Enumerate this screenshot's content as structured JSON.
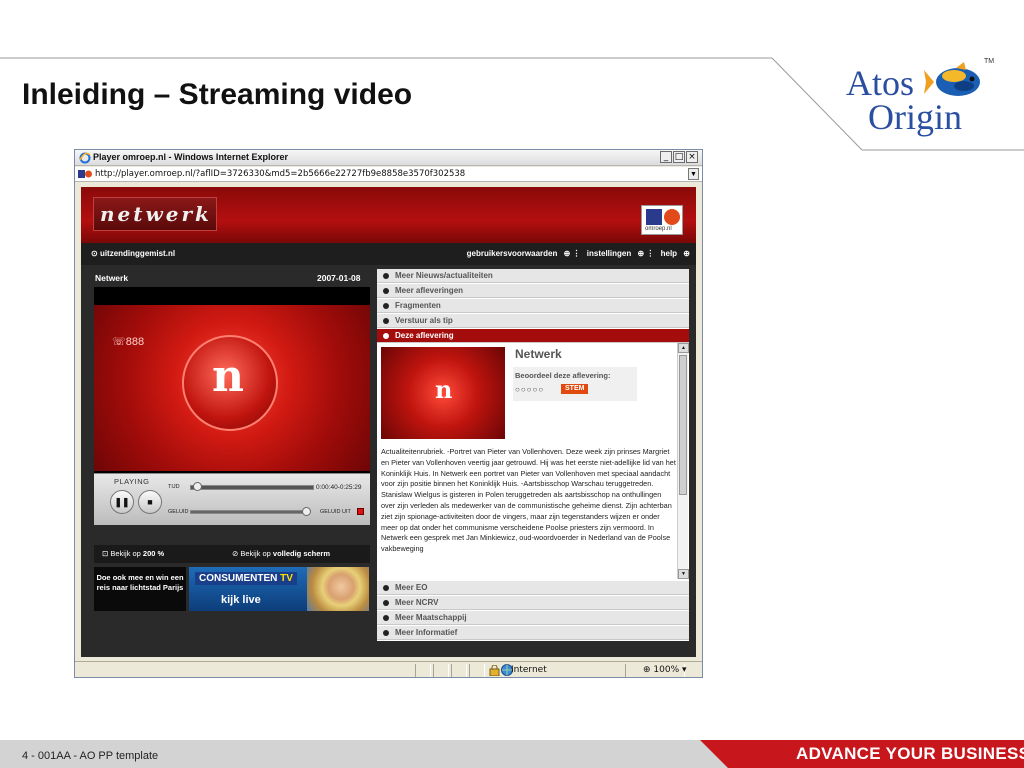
{
  "slide": {
    "title": "Inleiding – Streaming video",
    "footer_text": "4 - 001AA - AO PP template",
    "footer_slogan": "ADVANCE YOUR BUSINESS",
    "footer_arrows": "»",
    "logo_line1": "Atos",
    "logo_line2": "Origin",
    "logo_tm": "TM"
  },
  "browser": {
    "title": "Player omroep.nl - Windows Internet Explorer",
    "address": "http://player.omroep.nl/?aflID=3726330&md5=2b5666e22727fb9e8858e3570f302538",
    "minimize": "_",
    "maximize": "□",
    "close": "×",
    "status_zone": "Internet",
    "zoom": "100%"
  },
  "site": {
    "logo": "netwerk",
    "badge": "omroep.nl",
    "nav_left": "uitzendinggemist.nl",
    "nav_right": [
      "gebruikersvoorwaarden",
      "instellingen",
      "help"
    ],
    "program": "Netwerk",
    "date": "2007-01-08",
    "video_channel": "888",
    "player": {
      "state": "PLAYING",
      "time_label": "TIJD",
      "time": "0:00:40-0:25:29",
      "progress_fraction": 0.03,
      "volume_label": "GELUID",
      "mute_label": "GELUID UIT"
    },
    "view_options": [
      {
        "prefix": "Bekijk op ",
        "bold": "200 %"
      },
      {
        "prefix": "Bekijk op ",
        "bold": "volledig scherm"
      }
    ],
    "promo1": "Doe ook mee en win een reis naar lichtstad Parijs",
    "promo2_title": "CONSUMENTEN",
    "promo2_tv": "TV",
    "promo2_live": "kijk live",
    "menu_top": [
      "Meer Nieuws/actualiteiten",
      "Meer afleveringen",
      "Fragmenten",
      "Verstuur als tip",
      "Deze aflevering"
    ],
    "menu_bottom": [
      "Meer EO",
      "Meer NCRV",
      "Meer Maatschappij",
      "Meer Informatief"
    ],
    "episode": {
      "name": "Netwerk",
      "rating_label": "Beoordeel deze aflevering:",
      "stars": "○○○○○",
      "vote": "STEM",
      "description": "Actualiteitenrubriek. -Portret van Pieter van Vollenhoven. Deze week zijn prinses Margriet en Pieter van Vollenhoven veertig jaar getrouwd. Hij was het eerste niet-adellijke lid van het Koninklijk Huis. In Netwerk een portret van Pieter van Vollenhoven met speciaal aandacht voor zijn positie binnen het Koninklijk Huis. -Aartsbisschop Warschau teruggetreden. Stanislaw Wielgus is gisteren in Polen teruggetreden als aartsbisschop na onthullingen over zijn verleden als medewerker van de communistische geheime dienst. Zijn achterban ziet zijn spionage-activiteiten door de vingers, maar zijn tegenstanders wijzen er onder meer op dat onder het communisme verscheidene Poolse priesters zijn vermoord. In Netwerk een gesprek met Jan Minkiewicz, oud-woordvoerder in Nederland van de Poolse vakbeweging"
    }
  },
  "colors": {
    "site_red": "#a50d0d",
    "footer_red": "#c8161d",
    "logo_blue": "#2a4ea0"
  }
}
